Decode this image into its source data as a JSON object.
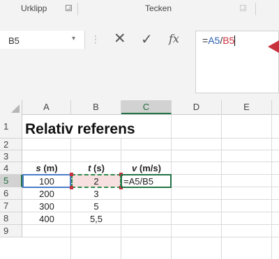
{
  "ribbon": {
    "groups": [
      {
        "label": "Urklipp"
      },
      {
        "label": "Tecken"
      }
    ]
  },
  "formula_bar": {
    "name_box": "B5",
    "formula_prefix": "=",
    "formula_ref1": "A5",
    "formula_op": "/",
    "formula_ref2": "B5",
    "cancel_glyph": "✕",
    "enter_glyph": "✓",
    "fx_label": "fx"
  },
  "grid": {
    "columns": [
      "A",
      "B",
      "C",
      "D",
      "E"
    ],
    "selected_column": "C",
    "rows": [
      "1",
      "2",
      "3",
      "4",
      "5",
      "6",
      "7",
      "8",
      "9"
    ],
    "selected_row": "5",
    "title": "Relativ referens",
    "headers": {
      "a4_var": "s",
      "a4_unit": "(m)",
      "b4_var": "t",
      "b4_unit": "(s)",
      "c4_var": "v",
      "c4_unit": "(m/s)"
    },
    "data_rows": [
      {
        "a": "100",
        "b": "2",
        "c": "=A5/B5"
      },
      {
        "a": "200",
        "b": "3",
        "c": ""
      },
      {
        "a": "300",
        "b": "5",
        "c": ""
      },
      {
        "a": "400",
        "b": "5,5",
        "c": ""
      }
    ]
  },
  "colors": {
    "ref_a5": "#4a7cc8",
    "ref_b5": "#c8323f",
    "excel_green": "#217346"
  }
}
